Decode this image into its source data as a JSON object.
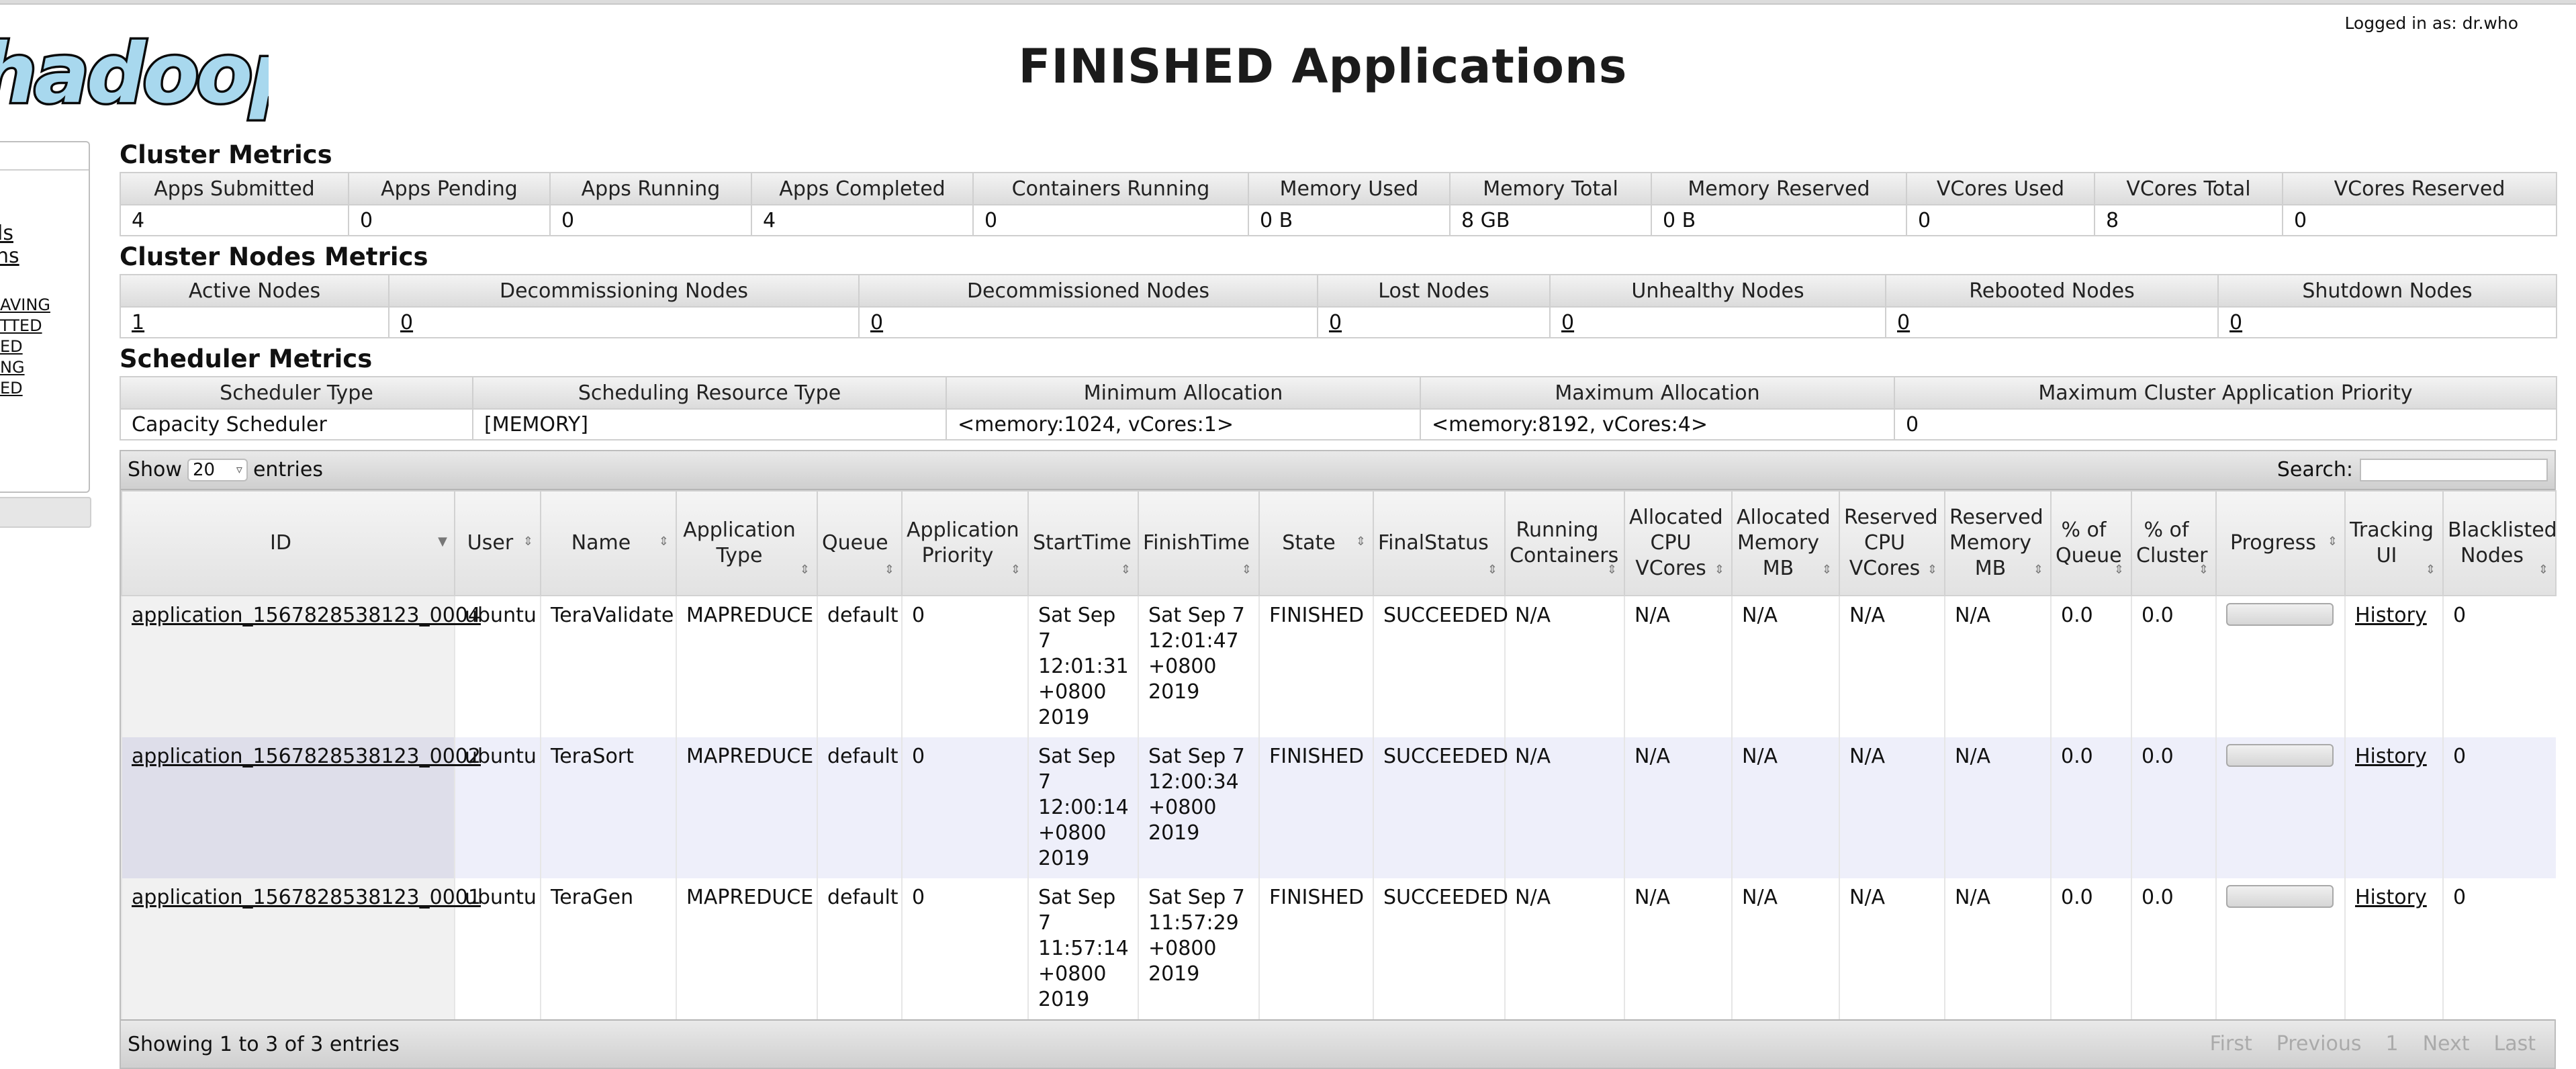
{
  "header": {
    "logo_text": "hadoop",
    "logged_in": "Logged in as: dr.who",
    "title": "FINISHED Applications"
  },
  "sidebar": {
    "items": [
      "ls",
      "ns",
      "AVING",
      "TTED",
      "ED",
      "NG",
      "ED"
    ]
  },
  "cluster_metrics": {
    "title": "Cluster Metrics",
    "headers": [
      "Apps Submitted",
      "Apps Pending",
      "Apps Running",
      "Apps Completed",
      "Containers Running",
      "Memory Used",
      "Memory Total",
      "Memory Reserved",
      "VCores Used",
      "VCores Total",
      "VCores Reserved"
    ],
    "values": [
      "4",
      "0",
      "0",
      "4",
      "0",
      "0 B",
      "8 GB",
      "0 B",
      "0",
      "8",
      "0"
    ]
  },
  "nodes_metrics": {
    "title": "Cluster Nodes Metrics",
    "headers": [
      "Active Nodes",
      "Decommissioning Nodes",
      "Decommissioned Nodes",
      "Lost Nodes",
      "Unhealthy Nodes",
      "Rebooted Nodes",
      "Shutdown Nodes"
    ],
    "values": [
      "1",
      "0",
      "0",
      "0",
      "0",
      "0",
      "0"
    ]
  },
  "scheduler_metrics": {
    "title": "Scheduler Metrics",
    "headers": [
      "Scheduler Type",
      "Scheduling Resource Type",
      "Minimum Allocation",
      "Maximum Allocation",
      "Maximum Cluster Application Priority"
    ],
    "values": [
      "Capacity Scheduler",
      "[MEMORY]",
      "<memory:1024, vCores:1>",
      "<memory:8192, vCores:4>",
      "0"
    ]
  },
  "apps_table": {
    "show_label": "Show",
    "entries_label": "entries",
    "page_size": "20",
    "search_label": "Search:",
    "columns": [
      "ID",
      "User",
      "Name",
      "Application Type",
      "Queue",
      "Application Priority",
      "StartTime",
      "FinishTime",
      "State",
      "FinalStatus",
      "Running Containers",
      "Allocated CPU VCores",
      "Allocated Memory MB",
      "Reserved CPU VCores",
      "Reserved Memory MB",
      "% of Queue",
      "% of Cluster",
      "Progress",
      "Tracking UI",
      "Blacklisted Nodes"
    ],
    "rows": [
      {
        "id": "application_1567828538123_0004",
        "user": "ubuntu",
        "name": "TeraValidate",
        "type": "MAPREDUCE",
        "queue": "default",
        "priority": "0",
        "start": "Sat Sep 7 12:01:31 +0800 2019",
        "finish": "Sat Sep 7 12:01:47 +0800 2019",
        "state": "FINISHED",
        "final": "SUCCEEDED",
        "running": "N/A",
        "alloc_cpu": "N/A",
        "alloc_mem": "N/A",
        "res_cpu": "N/A",
        "res_mem": "N/A",
        "pct_queue": "0.0",
        "pct_cluster": "0.0",
        "tracking": "History",
        "blacklisted": "0"
      },
      {
        "id": "application_1567828538123_0002",
        "user": "ubuntu",
        "name": "TeraSort",
        "type": "MAPREDUCE",
        "queue": "default",
        "priority": "0",
        "start": "Sat Sep 7 12:00:14 +0800 2019",
        "finish": "Sat Sep 7 12:00:34 +0800 2019",
        "state": "FINISHED",
        "final": "SUCCEEDED",
        "running": "N/A",
        "alloc_cpu": "N/A",
        "alloc_mem": "N/A",
        "res_cpu": "N/A",
        "res_mem": "N/A",
        "pct_queue": "0.0",
        "pct_cluster": "0.0",
        "tracking": "History",
        "blacklisted": "0"
      },
      {
        "id": "application_1567828538123_0001",
        "user": "ubuntu",
        "name": "TeraGen",
        "type": "MAPREDUCE",
        "queue": "default",
        "priority": "0",
        "start": "Sat Sep 7 11:57:14 +0800 2019",
        "finish": "Sat Sep 7 11:57:29 +0800 2019",
        "state": "FINISHED",
        "final": "SUCCEEDED",
        "running": "N/A",
        "alloc_cpu": "N/A",
        "alloc_mem": "N/A",
        "res_cpu": "N/A",
        "res_mem": "N/A",
        "pct_queue": "0.0",
        "pct_cluster": "0.0",
        "tracking": "History",
        "blacklisted": "0"
      }
    ],
    "info": "Showing 1 to 3 of 3 entries",
    "pager": [
      "First",
      "Previous",
      "1",
      "Next",
      "Last"
    ]
  },
  "colors": {
    "logo_fill": "#a8d8ee",
    "logo_stroke": "#0a0a0a",
    "row_alt": "#eeeffa"
  },
  "icons": {
    "sort": "sort-both-icon",
    "sort_desc": "sort-desc-icon",
    "select": "chevron-down-icon"
  }
}
